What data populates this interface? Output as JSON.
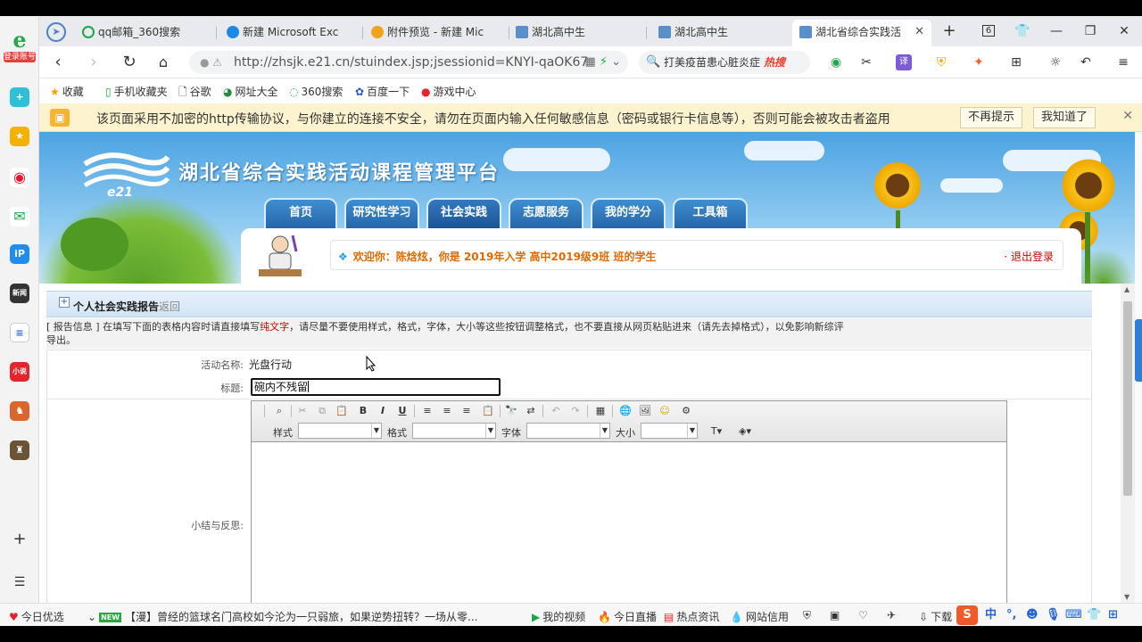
{
  "sidebar": {
    "account_label": "登录账号"
  },
  "tabs": [
    {
      "label": "qq邮箱_360搜索"
    },
    {
      "label": "新建 Microsoft Exc"
    },
    {
      "label": "附件预览 - 新建 Mic"
    },
    {
      "label": "湖北高中生"
    },
    {
      "label": "湖北高中生"
    },
    {
      "label": "湖北省综合实践活"
    }
  ],
  "window": {
    "tab_count": "6"
  },
  "address": {
    "url": "http://zhsjk.e21.cn/stuindex.jsp;jsessionid=KNYI-qaOK67",
    "search_text": "打美疫苗患心脏炎症",
    "search_hot": "热搜"
  },
  "bookmarks": [
    {
      "label": "收藏"
    },
    {
      "label": "手机收藏夹"
    },
    {
      "label": "谷歌"
    },
    {
      "label": "网址大全"
    },
    {
      "label": "360搜索"
    },
    {
      "label": "百度一下"
    },
    {
      "label": "游戏中心"
    }
  ],
  "warning": {
    "text": "该页面采用不加密的http传输协议，与你建立的连接不安全，请勿在页面内输入任何敏感信息（密码或银行卡信息等），否则可能会被攻击者盗用",
    "dismiss_label": "不再提示",
    "ack_label": "我知道了"
  },
  "site": {
    "logo_text": "e21",
    "title": "湖北省综合实践活动课程管理平台",
    "nav": [
      "首页",
      "研究性学习",
      "社会实践",
      "志愿服务",
      "我的学分",
      "工具箱"
    ],
    "active_nav": "社会实践",
    "welcome": "欢迎你：陈焓炫，你是 2019年入学 高中2019级9班 班的学生",
    "logout": "· 退出登录"
  },
  "section": {
    "title": "个人社会实践报告",
    "back": "返回",
    "notice_prefix": "[ 报告信息 ] 在填写下面的表格内容时请直接填写",
    "notice_red": "纯文字",
    "notice_suffix": "，请尽量不要使用样式，格式，字体，大小等这些按钮调整格式，也不要直接从网页粘贴进来（请先去掉格式），以免影响新综评",
    "notice_line2": "导出。"
  },
  "form": {
    "activity_label": "活动名称:",
    "activity_value": "光盘行动",
    "title_label": "标题:",
    "title_value": "碗内不残留",
    "summary_label": "小结与反思:",
    "toolbar": {
      "style_label": "样式",
      "format_label": "格式",
      "font_label": "字体",
      "size_label": "大小"
    }
  },
  "statusbar": {
    "left": "今日优选",
    "news_badge": "NEW",
    "news": "【漫】曾经的篮球名门高校如今沦为一只弱旅，如果逆势扭转？一场从零...",
    "video": "我的视频",
    "live": "今日直播",
    "hot": "热点资讯",
    "credit": "网站信用",
    "download": "下载",
    "ime": "中"
  },
  "colors": {
    "accent": "#2467aa",
    "warning_bg": "#fdf4cf",
    "welcome_text": "#e06a00"
  }
}
